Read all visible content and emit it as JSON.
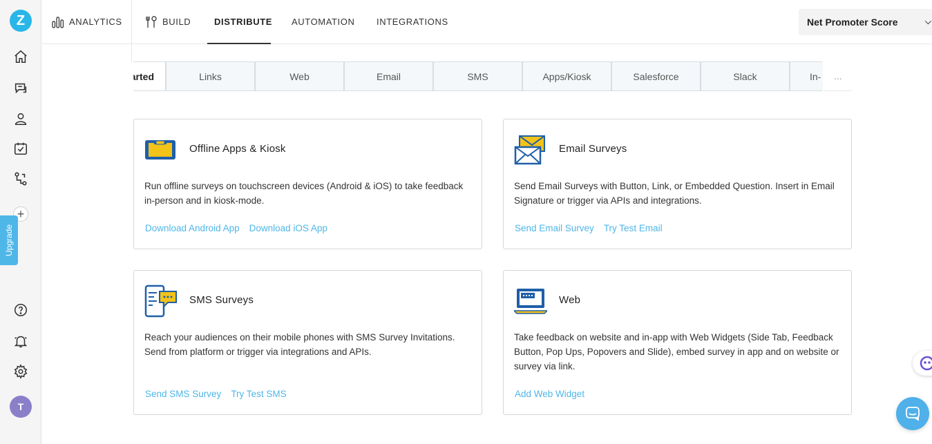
{
  "sidebar": {
    "logo_letter": "Z",
    "icons": [
      "home-icon",
      "chat-icon",
      "user-icon",
      "calendar-check-icon",
      "workflow-icon",
      "plus-icon",
      "help-icon",
      "bell-icon",
      "settings-icon"
    ],
    "plus_label": "+",
    "upgrade_label": "Upgrade",
    "avatar_initial": "T"
  },
  "topnav": {
    "items": [
      {
        "label": "ANALYTICS",
        "icon": "analytics-icon"
      },
      {
        "label": "BUILD",
        "icon": "build-icon"
      },
      {
        "label": "DISTRIBUTE"
      },
      {
        "label": "AUTOMATION"
      },
      {
        "label": "INTEGRATIONS"
      }
    ],
    "active": "DISTRIBUTE",
    "survey_select": "Net Promoter Score",
    "chevron": "⌵"
  },
  "tabs": {
    "items": [
      "arted",
      "Links",
      "Web",
      "Email",
      "SMS",
      "Apps/Kiosk",
      "Salesforce",
      "Slack",
      "In-"
    ],
    "more": "..."
  },
  "cards": [
    {
      "title": "Offline Apps & Kiosk",
      "icon": "tablet-kiosk-icon",
      "desc": "Run offline surveys on touchscreen devices (Android & iOS) to take feedback in-person and in kiosk-mode.",
      "links": [
        "Download Android App",
        "Download iOS App"
      ]
    },
    {
      "title": "Email Surveys",
      "icon": "envelope-icon",
      "desc": "Send Email Surveys with Button, Link, or Embedded Question. Insert in Email Signature or trigger via APIs and integrations.",
      "links": [
        "Send Email Survey",
        "Try Test Email"
      ]
    },
    {
      "title": "SMS Surveys",
      "icon": "phone-message-icon",
      "desc": "Reach your audiences on their mobile phones with SMS Survey Invitations. Send from platform or trigger via integrations and APIs.",
      "links": [
        "Send SMS Survey",
        "Try Test SMS"
      ]
    },
    {
      "title": "Web",
      "icon": "laptop-icon",
      "desc": "Take feedback on website and in-app with Web Widgets (Side Tab, Feedback Button, Pop Ups, Popovers and Slide), embed survey in app and on website or survey via link.",
      "links": [
        "Add Web Widget"
      ]
    }
  ],
  "colors": {
    "accent": "#4fb6e8",
    "logo": "#29b6e8",
    "avatar": "#8a7fc9",
    "icon_blue": "#1f5fa8",
    "icon_yellow": "#f2c318"
  }
}
